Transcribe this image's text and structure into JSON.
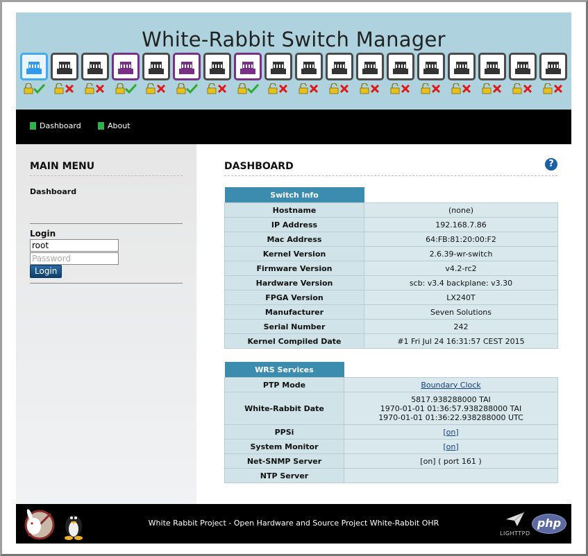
{
  "header": {
    "title": "White-Rabbit Switch Manager",
    "ports": [
      {
        "state": "active",
        "lock": "locked",
        "link": "ok"
      },
      {
        "state": "down",
        "lock": "unlocked",
        "link": "fail"
      },
      {
        "state": "down",
        "lock": "unlocked",
        "link": "fail"
      },
      {
        "state": "purple",
        "lock": "locked",
        "link": "ok"
      },
      {
        "state": "down",
        "lock": "unlocked",
        "link": "fail"
      },
      {
        "state": "purple",
        "lock": "locked",
        "link": "ok"
      },
      {
        "state": "down",
        "lock": "unlocked",
        "link": "fail"
      },
      {
        "state": "purple",
        "lock": "locked",
        "link": "ok"
      },
      {
        "state": "down",
        "lock": "unlocked",
        "link": "fail"
      },
      {
        "state": "down",
        "lock": "unlocked",
        "link": "fail"
      },
      {
        "state": "down",
        "lock": "unlocked",
        "link": "fail"
      },
      {
        "state": "down",
        "lock": "unlocked",
        "link": "fail"
      },
      {
        "state": "down",
        "lock": "unlocked",
        "link": "fail"
      },
      {
        "state": "down",
        "lock": "unlocked",
        "link": "fail"
      },
      {
        "state": "down",
        "lock": "unlocked",
        "link": "fail"
      },
      {
        "state": "down",
        "lock": "unlocked",
        "link": "fail"
      },
      {
        "state": "down",
        "lock": "unlocked",
        "link": "fail"
      },
      {
        "state": "down",
        "lock": "unlocked",
        "link": "fail"
      }
    ]
  },
  "nav": {
    "items": [
      {
        "label": "Dashboard"
      },
      {
        "label": "About"
      }
    ]
  },
  "sidebar": {
    "heading": "MAIN MENU",
    "link": "Dashboard",
    "login_label": "Login",
    "username_value": "root",
    "password_placeholder": "Password",
    "login_button": "Login"
  },
  "main": {
    "heading": "DASHBOARD",
    "help_icon": "?",
    "switch_info": {
      "title": "Switch Info",
      "rows": [
        {
          "key": "Hostname",
          "value": "(none)"
        },
        {
          "key": "IP Address",
          "value": "192.168.7.86"
        },
        {
          "key": "Mac Address",
          "value": "64:FB:81:20:00:F2"
        },
        {
          "key": "Kernel Version",
          "value": "2.6.39-wr-switch"
        },
        {
          "key": "Firmware Version",
          "value": "v4.2-rc2"
        },
        {
          "key": "Hardware Version",
          "value": "scb: v3.4 backplane: v3.30"
        },
        {
          "key": "FPGA Version",
          "value": "LX240T"
        },
        {
          "key": "Manufacturer",
          "value": "Seven Solutions"
        },
        {
          "key": "Serial Number",
          "value": "242"
        },
        {
          "key": "Kernel Compiled Date",
          "value": "#1 Fri Jul 24 16:31:57 CEST 2015"
        }
      ]
    },
    "services": {
      "title": "WRS Services",
      "ptp_mode_key": "PTP Mode",
      "ptp_mode_value": "Boundary Clock",
      "wr_date_key": "White-Rabbit Date",
      "wr_date_line1": "5817.938288000 TAI",
      "wr_date_line2": "1970-01-01 01:36:57.938288000 TAI",
      "wr_date_line3": "1970-01-01 01:36:22.938288000 UTC",
      "ppsi_key": "PPSi",
      "ppsi_value": "[on]",
      "sysmon_key": "System Monitor",
      "sysmon_value": "[on]",
      "snmp_key": "Net-SNMP Server",
      "snmp_value": "[on] ( port 161 )",
      "ntp_key": "NTP Server",
      "ntp_value": ""
    }
  },
  "footer": {
    "text": "White Rabbit Project - Open Hardware and Source Project White-Rabbit OHR",
    "php_logo": "php",
    "lighttpd_logo": "LIGHTTPD"
  },
  "colors": {
    "header_bg": "#aed3de",
    "active_port": "#44aaee",
    "purple_port": "#7a2f86",
    "table_header": "#3c8cb0",
    "nav_square": "#2fb24b"
  }
}
